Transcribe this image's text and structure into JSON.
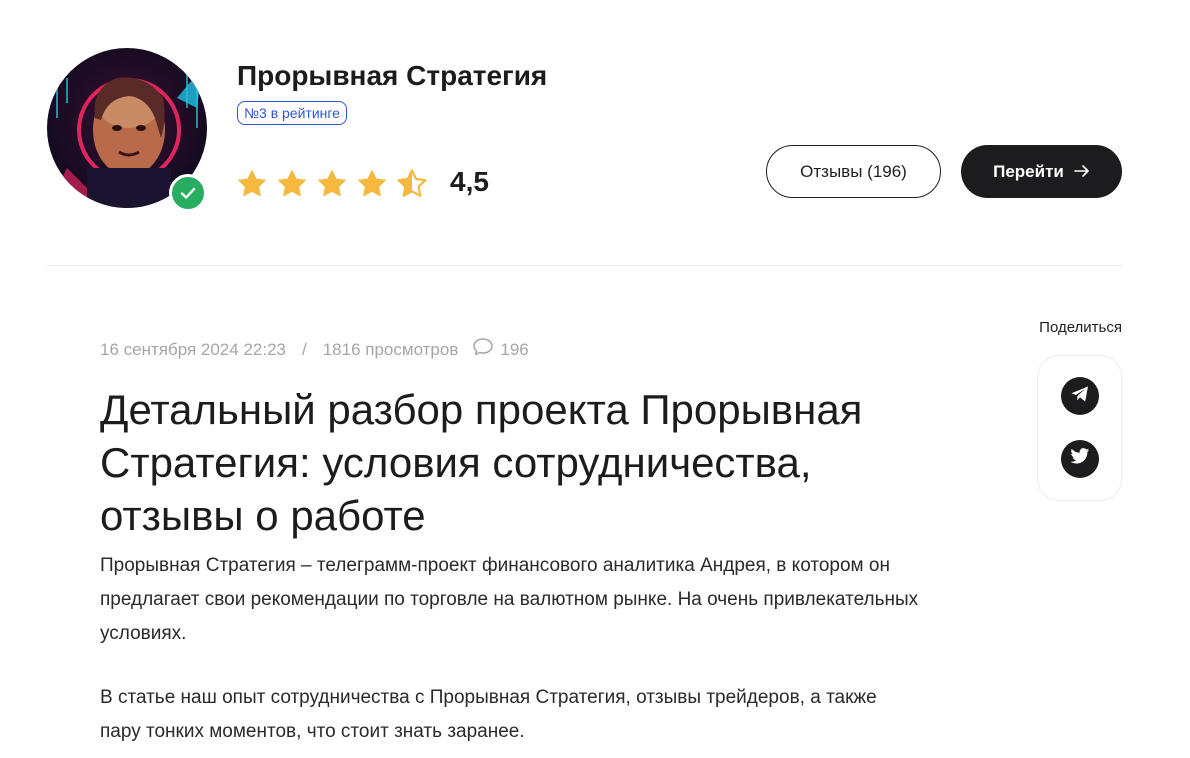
{
  "project": {
    "title": "Прорывная Стратегия",
    "rank_badge": "№3 в рейтинге",
    "rating": 4.5,
    "rating_text": "4,5",
    "stars": [
      "full",
      "full",
      "full",
      "full",
      "half"
    ],
    "star_color": "#f4b93e",
    "verified": true
  },
  "actions": {
    "reviews_label": "Отзывы (196)",
    "go_label": "Перейти",
    "go_icon": "arrow-right-icon"
  },
  "article": {
    "date": "16 сентября 2024 22:23",
    "separator": "/",
    "views": "1816 просмотров",
    "comments_count": "196",
    "title": "Детальный разбор проекта Прорывная Стратегия: условия сотрудничества, отзывы о работе",
    "paragraphs": [
      "Прорывная Стратегия – телеграмм-проект финансового аналитика Андрея, в котором он предлагает свои рекомендации по торговле на валютном рынке. На очень привлекательных условиях.",
      "В статье наш опыт сотрудничества с Прорывная Стратегия, отзывы трейдеров, а также пару тонких моментов, что стоит знать заранее."
    ]
  },
  "share": {
    "label": "Поделиться",
    "buttons": [
      "telegram-icon",
      "twitter-icon"
    ]
  },
  "colors": {
    "accent_blue": "#2f55d4",
    "verified_green": "#27ae60",
    "dark": "#1c1c1e",
    "muted": "#a6a6a6"
  }
}
